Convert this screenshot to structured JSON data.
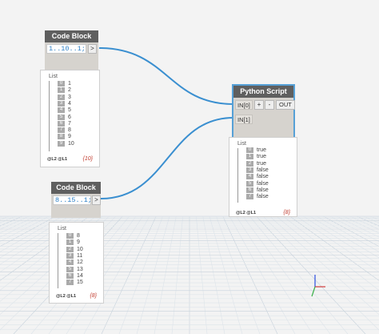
{
  "code_block_1": {
    "title": "Code Block",
    "code": "1..10..1;",
    "out_port": ">",
    "preview": {
      "title": "List",
      "items": [
        {
          "index": "0",
          "value": "1"
        },
        {
          "index": "1",
          "value": "2"
        },
        {
          "index": "2",
          "value": "3"
        },
        {
          "index": "3",
          "value": "4"
        },
        {
          "index": "4",
          "value": "5"
        },
        {
          "index": "5",
          "value": "6"
        },
        {
          "index": "6",
          "value": "7"
        },
        {
          "index": "7",
          "value": "8"
        },
        {
          "index": "8",
          "value": "9"
        },
        {
          "index": "9",
          "value": "10"
        }
      ],
      "levels": "@L2 @L1",
      "count": "{10}"
    }
  },
  "code_block_2": {
    "title": "Code Block",
    "code": "8..15..1;",
    "out_port": ">",
    "preview": {
      "title": "List",
      "items": [
        {
          "index": "0",
          "value": "8"
        },
        {
          "index": "1",
          "value": "9"
        },
        {
          "index": "2",
          "value": "10"
        },
        {
          "index": "3",
          "value": "11"
        },
        {
          "index": "4",
          "value": "12"
        },
        {
          "index": "5",
          "value": "13"
        },
        {
          "index": "6",
          "value": "14"
        },
        {
          "index": "7",
          "value": "15"
        }
      ],
      "levels": "@L2 @L1",
      "count": "{8}"
    }
  },
  "python_script": {
    "title": "Python Script",
    "inputs": [
      "IN[0]",
      "IN[1]"
    ],
    "add_port": "+",
    "remove_port": "-",
    "output": "OUT",
    "preview": {
      "title": "List",
      "items": [
        {
          "index": "0",
          "value": "true"
        },
        {
          "index": "1",
          "value": "true"
        },
        {
          "index": "2",
          "value": "true"
        },
        {
          "index": "3",
          "value": "false"
        },
        {
          "index": "4",
          "value": "false"
        },
        {
          "index": "5",
          "value": "false"
        },
        {
          "index": "6",
          "value": "false"
        },
        {
          "index": "7",
          "value": "false"
        }
      ],
      "levels": "@L2 @L1",
      "count": "{8}"
    }
  },
  "colors": {
    "wire": "#3a8fd0",
    "node_header": "#5f5f5f",
    "node_body": "#d6d3ce",
    "selection": "#56a0d6",
    "code_text": "#2a7fc7",
    "count_text": "#c0392b"
  }
}
